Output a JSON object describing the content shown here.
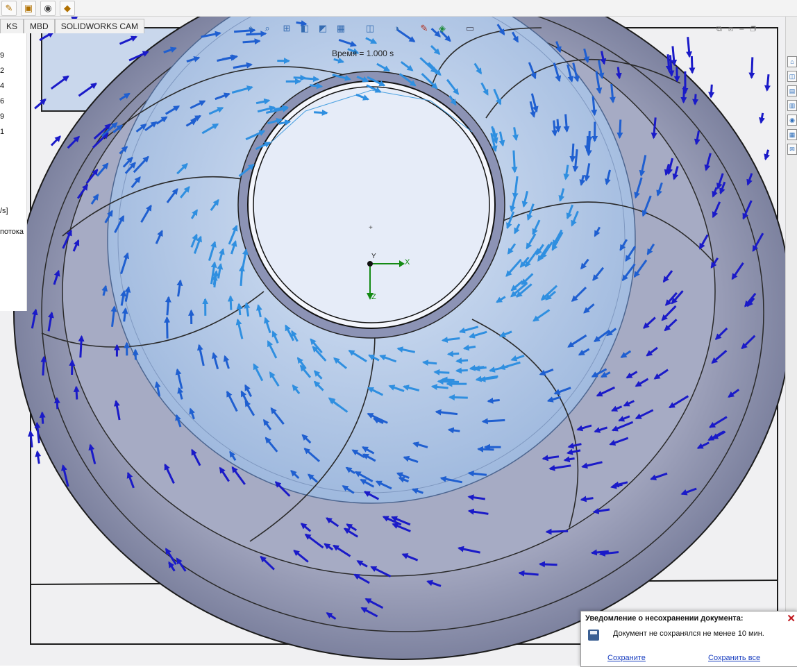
{
  "toolbar": {
    "icons": [
      "sketch-icon",
      "part-icon",
      "camera-icon",
      "assembly-icon"
    ]
  },
  "tabs": [
    {
      "label": "KS"
    },
    {
      "label": "MBD"
    },
    {
      "label": "SOLIDWORKS CAM"
    }
  ],
  "left_panel": {
    "numbers": [
      "9",
      "2",
      "4",
      "6",
      "9",
      "1"
    ],
    "unit": "/s]",
    "text": "потока"
  },
  "view_toolbar": {
    "icons": [
      "view-orientation-icon",
      "zoom-to-fit-icon",
      "zoom-area-icon",
      "previous-view-icon",
      "section-view-icon",
      "view-settings-icon",
      "display-style-icon",
      "hide-show-icon",
      "appearance-icon",
      "scene-icon",
      "monitor-icon"
    ]
  },
  "viewport": {
    "time_label": "Время = 1.000 s",
    "triad": {
      "x": "X",
      "y": "Y",
      "z": "Z"
    }
  },
  "notification": {
    "title": "Уведомление о несохранении документа:",
    "message": "Документ не сохранялся не менее 10 мин.",
    "link_save": "Сохраните",
    "link_save_all": "Сохранить все"
  },
  "colors": {
    "arrow_dark": "#1a1ac8",
    "arrow_mid": "#1f5fd0",
    "arrow_light": "#2f8fe0",
    "housing": "#a9aec7",
    "inner_blue": "#c4d7f0"
  }
}
